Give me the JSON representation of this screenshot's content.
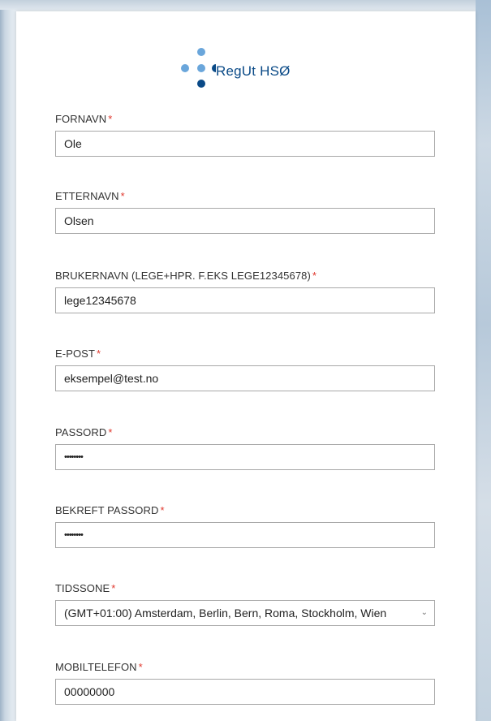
{
  "logo": {
    "text": "RegUt HSØ"
  },
  "form": {
    "fields": [
      {
        "label": "FORNAVN",
        "required": "*",
        "value": "Ole"
      },
      {
        "label": "ETTERNAVN",
        "required": "*",
        "value": "Olsen"
      },
      {
        "label": "BRUKERNAVN (LEGE+HPR. F.EKS LEGE12345678)",
        "required": "*",
        "value": "lege12345678"
      },
      {
        "label": "E-POST",
        "required": "*",
        "value": "eksempel@test.no"
      },
      {
        "label": "PASSORD",
        "required": "*",
        "value": "••••••••"
      },
      {
        "label": "BEKREFT PASSORD",
        "required": "*",
        "value": "••••••••"
      },
      {
        "label": "TIDSSONE",
        "required": "*",
        "value": "(GMT+01:00) Amsterdam, Berlin, Bern, Roma, Stockholm, Wien"
      },
      {
        "label": "MOBILTELEFON",
        "required": "*",
        "value": "00000000"
      }
    ]
  },
  "colors": {
    "required": "#e0382e",
    "logo_dark": "#0a4a87",
    "logo_light": "#6aa6db"
  },
  "icons": {
    "logo": "regut-dots-logo",
    "dropdown": "chevron-down-icon"
  }
}
